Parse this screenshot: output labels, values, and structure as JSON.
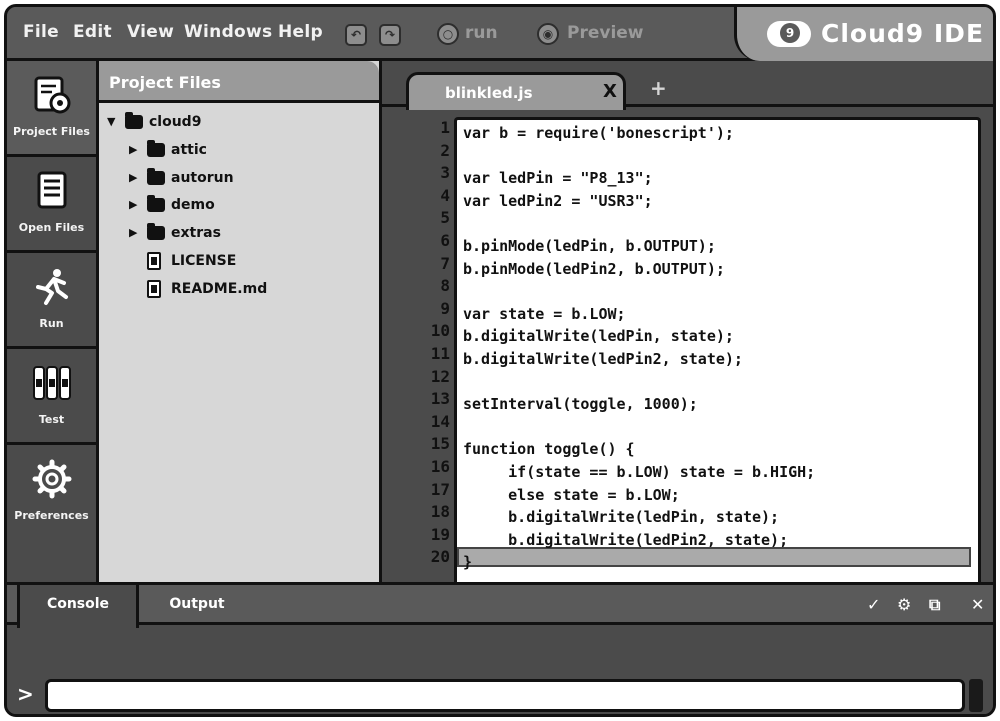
{
  "menubar": {
    "items": [
      "File",
      "Edit",
      "View",
      "Windows",
      "Help"
    ],
    "run_label": "run",
    "preview_label": "Preview",
    "brand_name": "Cloud9 IDE",
    "brand_badge": "9"
  },
  "sidebar": {
    "items": [
      {
        "label": "Project Files",
        "icon": "project-files-icon"
      },
      {
        "label": "Open Files",
        "icon": "open-files-icon"
      },
      {
        "label": "Run",
        "icon": "run-icon"
      },
      {
        "label": "Test",
        "icon": "test-icon"
      },
      {
        "label": "Preferences",
        "icon": "gear-icon"
      }
    ]
  },
  "project": {
    "title": "Project Files",
    "root": "cloud9",
    "folders": [
      "attic",
      "autorun",
      "demo",
      "extras"
    ],
    "files": [
      "LICENSE",
      "README.md"
    ]
  },
  "editor": {
    "tab_name": "blinkled.js",
    "tab_close": "X",
    "tab_add": "+",
    "line_numbers": [
      "1",
      "2",
      "3",
      "4",
      "5",
      "6",
      "7",
      "8",
      "9",
      "10",
      "11",
      "12",
      "13",
      "14",
      "15",
      "16",
      "17",
      "18",
      "19",
      "20"
    ],
    "lines": [
      "var b = require('bonescript');",
      "",
      "var ledPin = \"P8_13\";",
      "var ledPin2 = \"USR3\";",
      "",
      "b.pinMode(ledPin, b.OUTPUT);",
      "b.pinMode(ledPin2, b.OUTPUT);",
      "",
      "var state = b.LOW;",
      "b.digitalWrite(ledPin, state);",
      "b.digitalWrite(ledPin2, state);",
      "",
      "setInterval(toggle, 1000);",
      "",
      "function toggle() {",
      "     if(state == b.LOW) state = b.HIGH;",
      "     else state = b.LOW;",
      "     b.digitalWrite(ledPin, state);",
      "     b.digitalWrite(ledPin2, state);",
      "}"
    ]
  },
  "console": {
    "tabs": [
      "Console",
      "Output"
    ],
    "prompt": ">",
    "icons": {
      "check": "✓",
      "settings": "⚙",
      "popout": "⧉",
      "close": "✕"
    }
  }
}
